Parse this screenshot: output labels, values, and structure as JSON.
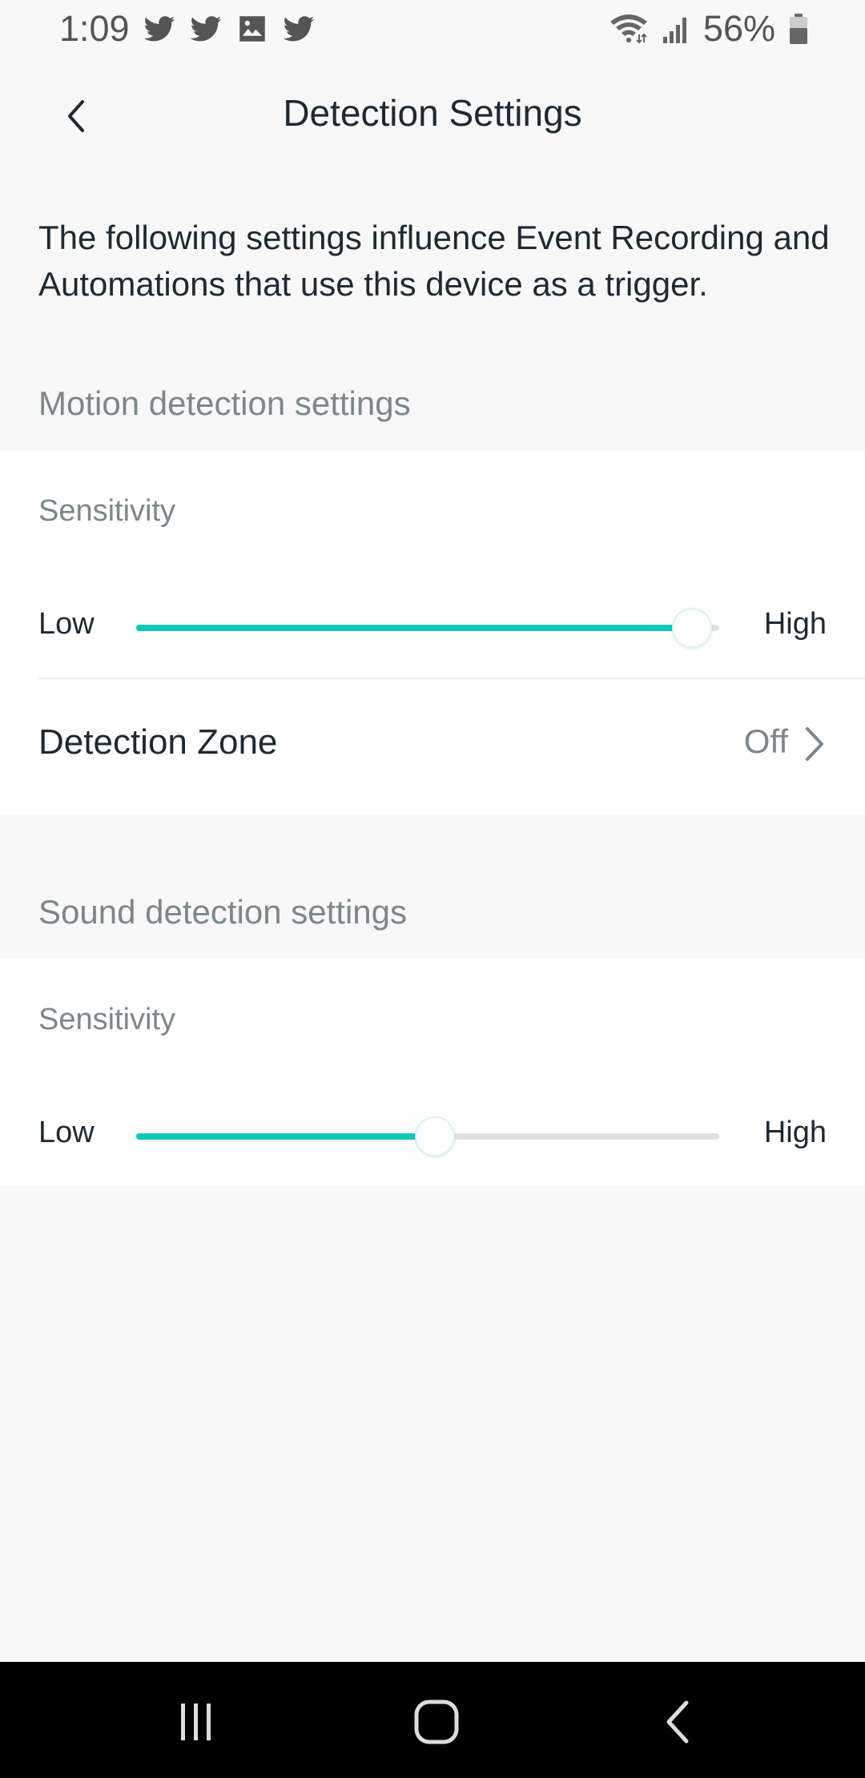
{
  "status_bar": {
    "time": "1:09",
    "notification_icons": [
      "twitter-icon",
      "twitter-icon",
      "image-icon",
      "twitter-icon"
    ],
    "battery": "56%"
  },
  "header": {
    "title": "Detection Settings"
  },
  "intro_text": "The following settings influence Event Recording and Automations that use this device as a trigger.",
  "motion": {
    "heading": "Motion detection settings",
    "sensitivity_label": "Sensitivity",
    "low_label": "Low",
    "high_label": "High",
    "sensitivity_value": 0.95,
    "zone_label": "Detection Zone",
    "zone_value": "Off"
  },
  "sound": {
    "heading": "Sound detection settings",
    "sensitivity_label": "Sensitivity",
    "low_label": "Low",
    "high_label": "High",
    "sensitivity_value": 0.51
  },
  "colors": {
    "accent": "#11c8b8",
    "background": "#f8f8f8",
    "card": "#ffffff"
  }
}
